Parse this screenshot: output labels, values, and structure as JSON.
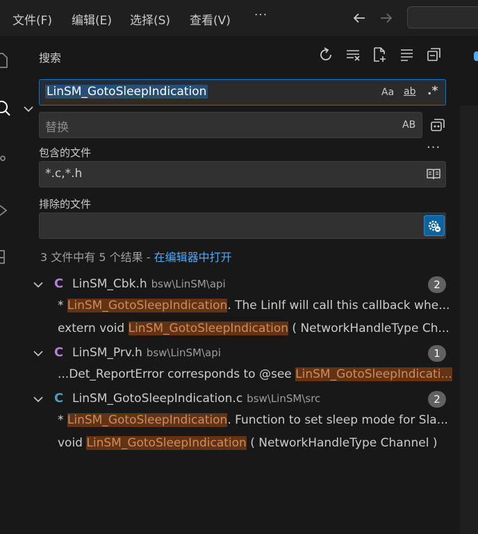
{
  "menu": {
    "file": "文件(F)",
    "edit": "编辑(E)",
    "selection": "选择(S)",
    "view": "查看(V)",
    "more": "···"
  },
  "sidebar": {
    "title": "搜索",
    "search": {
      "value": "LinSM_GotoSleepIndication",
      "match_case": "Aa",
      "whole_word": "ab",
      "regex": ".*"
    },
    "replace": {
      "placeholder": "替换",
      "preserve_case": "AB"
    },
    "include": {
      "label": "包含的文件",
      "value": "*.c,*.h"
    },
    "exclude": {
      "label": "排除的文件",
      "value": ""
    },
    "more_options": "···",
    "summary": {
      "text": "3 文件中有 5 个结果 - ",
      "link": "在编辑器中打开"
    }
  },
  "results": [
    {
      "letter": "C",
      "letter_color": "#b180d7",
      "name": "LinSM_Cbk.h",
      "path": "bsw\\LinSM\\api",
      "count": "2",
      "matches": [
        {
          "pre": "* ",
          "hl": "LinSM_GotoSleepIndication",
          "post": ".  The LinIf will call this callback whe..."
        },
        {
          "pre": "extern void ",
          "hl": "LinSM_GotoSleepIndication",
          "post": " ( NetworkHandleType Ch..."
        }
      ]
    },
    {
      "letter": "C",
      "letter_color": "#b180d7",
      "name": "LinSM_Prv.h",
      "path": "bsw\\LinSM\\api",
      "count": "1",
      "matches": [
        {
          "pre": "...Det_ReportError corresponds to @see ",
          "hl": "LinSM_GotoSleepIndicati...",
          "post": ""
        }
      ]
    },
    {
      "letter": "C",
      "letter_color": "#519aba",
      "name": "LinSM_GotoSleepIndication.c",
      "path": "bsw\\LinSM\\src",
      "count": "2",
      "matches": [
        {
          "pre": "* ",
          "hl": "LinSM_GotoSleepIndication",
          "post": ".  Function to set sleep mode for Sla..."
        },
        {
          "pre": "void ",
          "hl": "LinSM_GotoSleepIndication",
          "post": " ( NetworkHandleType Channel )"
        }
      ]
    }
  ]
}
